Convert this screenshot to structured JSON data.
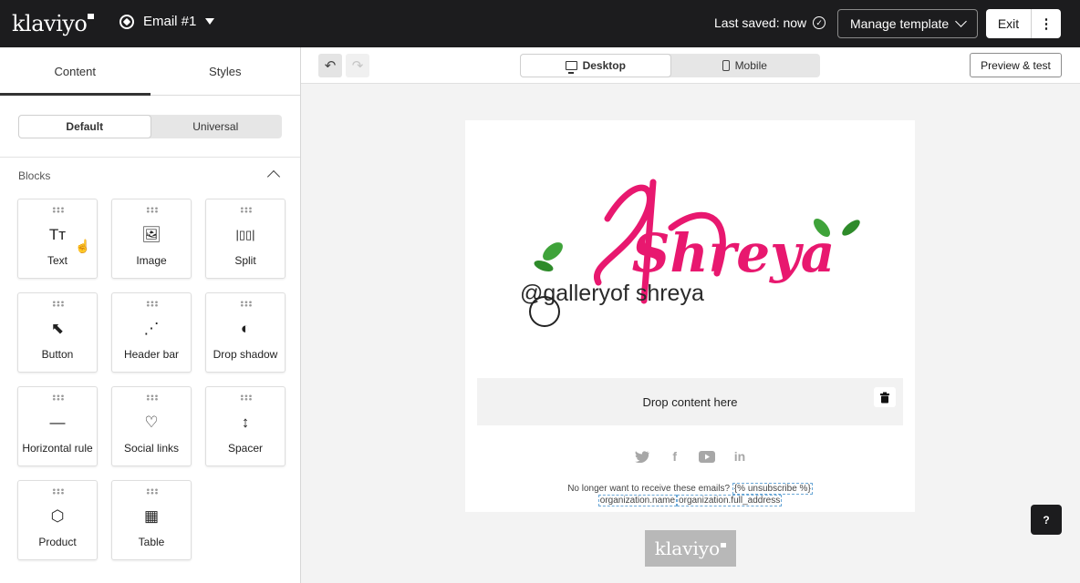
{
  "header": {
    "logo": "klaviyo",
    "email_name": "Email #1",
    "saved_status": "Last saved: now",
    "manage_label": "Manage template",
    "exit_label": "Exit",
    "more_label": "⋮"
  },
  "sidebar": {
    "tabs": [
      {
        "label": "Content"
      },
      {
        "label": "Styles"
      }
    ],
    "segments": [
      {
        "label": "Default"
      },
      {
        "label": "Universal"
      }
    ],
    "section_title": "Blocks",
    "blocks": [
      {
        "label": "Text",
        "icon": "Tт"
      },
      {
        "label": "Image",
        "icon": "🖼"
      },
      {
        "label": "Split",
        "icon": "|▯▯|"
      },
      {
        "label": "Button",
        "icon": "⬉"
      },
      {
        "label": "Header bar",
        "icon": "⋰"
      },
      {
        "label": "Drop shadow",
        "icon": "◐"
      },
      {
        "label": "Horizontal rule",
        "icon": "—"
      },
      {
        "label": "Social links",
        "icon": "♡"
      },
      {
        "label": "Spacer",
        "icon": "↕"
      },
      {
        "label": "Product",
        "icon": "⬡"
      },
      {
        "label": "Table",
        "icon": "▦"
      }
    ]
  },
  "canvas": {
    "devices": [
      {
        "label": "Desktop"
      },
      {
        "label": "Mobile"
      }
    ],
    "preview_label": "Preview & test",
    "brand_name": "Shreya",
    "brand_handle": "@galleryof shreya",
    "drop_text": "Drop content here",
    "footer_line1": "No longer want to receive these emails?",
    "unsubscribe_tag": "{% unsubscribe %}",
    "org_name_tag": "organization.name",
    "org_address_tag": "organization.full_address",
    "footer_logo": "klaviyo",
    "help_label": "?"
  },
  "colors": {
    "topbar": "#1c1c1e",
    "brand_pink": "#e8186f",
    "leaf_green": "#3fa33a"
  }
}
